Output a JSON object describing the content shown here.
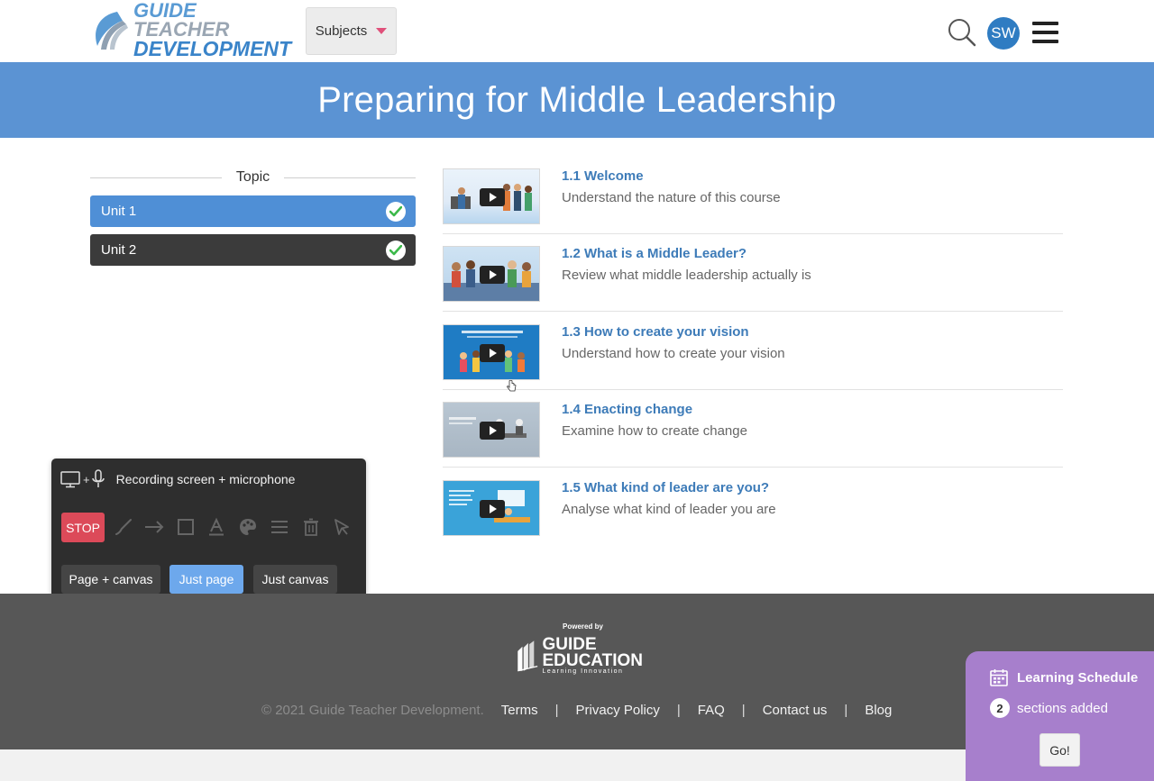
{
  "header": {
    "logo_line1": "GUIDE",
    "logo_line1b": "TEACHER",
    "logo_line2": "DEVELOPMENT",
    "subjects_label": "Subjects",
    "avatar_initials": "SW"
  },
  "banner": {
    "title": "Preparing for Middle Leadership"
  },
  "sidebar": {
    "topic_label": "Topic",
    "units": [
      {
        "label": "Unit 1",
        "selected": true,
        "completed": true
      },
      {
        "label": "Unit 2",
        "selected": false,
        "completed": true
      }
    ]
  },
  "lessons": [
    {
      "title": "1.1 Welcome",
      "description": "Understand the nature of this course"
    },
    {
      "title": "1.2 What is a Middle Leader?",
      "description": "Review what middle leadership actually is"
    },
    {
      "title": "1.3 How to create your vision",
      "description": "Understand how to create your vision"
    },
    {
      "title": "1.4 Enacting change",
      "description": "Examine how to create change"
    },
    {
      "title": "1.5 What kind of leader are you?",
      "description": "Analyse what kind of leader you are"
    }
  ],
  "recorder": {
    "status": "Recording screen + microphone",
    "stop_label": "STOP",
    "modes": [
      "Page + canvas",
      "Just page",
      "Just canvas"
    ],
    "active_mode": "Just page"
  },
  "footer": {
    "powered_by": "Powered by",
    "brand_line1": "GUIDE",
    "brand_line2": "EDUCATION",
    "brand_tagline": "Learning Innovation",
    "copyright": "© 2021 Guide Teacher Development.",
    "links": [
      "Terms",
      "Privacy Policy",
      "FAQ",
      "Contact us",
      "Blog"
    ]
  },
  "schedule": {
    "title": "Learning Schedule",
    "count": "2",
    "count_text": "sections added",
    "go_label": "Go!"
  },
  "colors": {
    "banner": "#5b93d3",
    "unit_selected": "#4f8fd6",
    "unit_default": "#3b3b3b",
    "lesson_title": "#3d7bb8",
    "stop": "#dc4a59",
    "mode_active": "#6da8ec",
    "footer": "#575757",
    "schedule": "#a77fcc"
  }
}
